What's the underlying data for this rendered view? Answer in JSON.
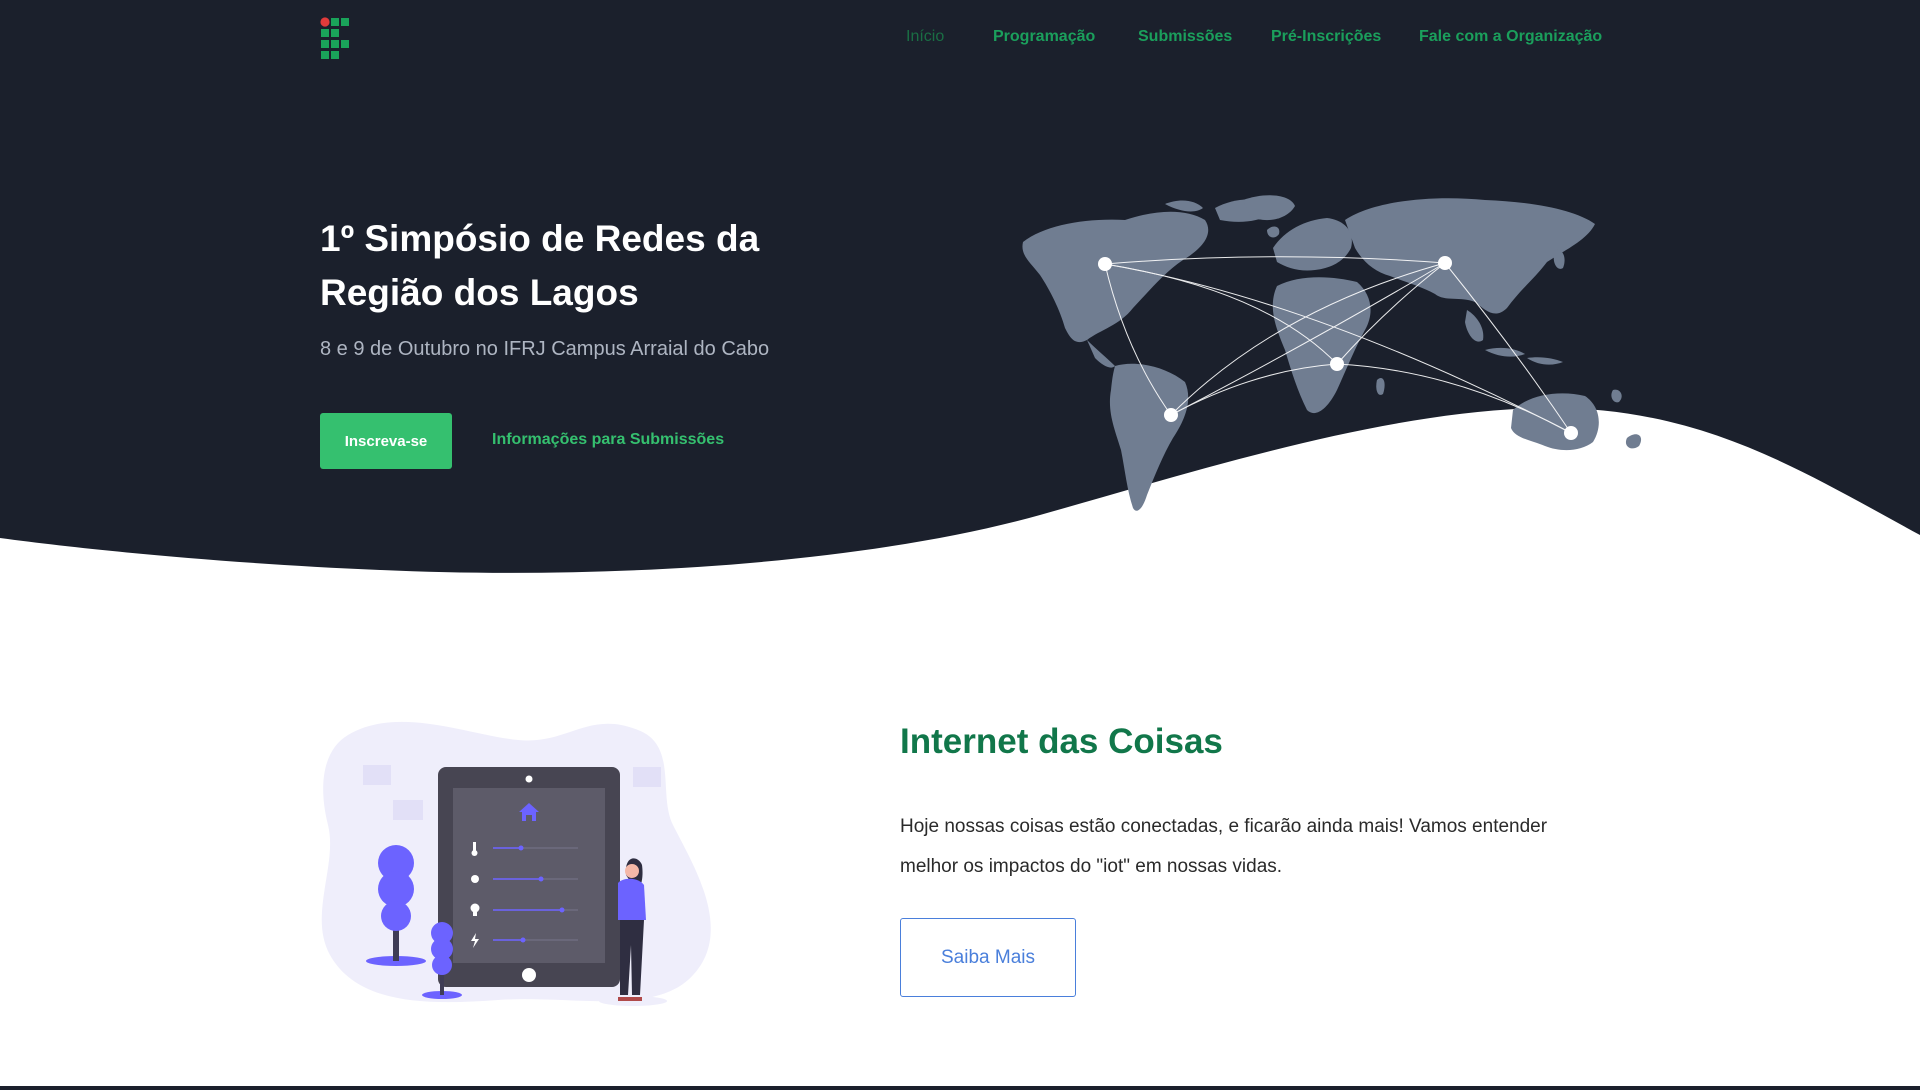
{
  "colors": {
    "dark_bg": "#1b202c",
    "accent_green": "#35c06f",
    "nav_green": "#1b9f5c",
    "heading_green": "#11774a",
    "outline_blue": "#4a7fdb",
    "map_gray": "#707d91",
    "illustration_purple": "#6c63ff"
  },
  "nav": {
    "logo_icon": "ifrj-logo",
    "items": [
      {
        "label": "Início",
        "active": true
      },
      {
        "label": "Programação"
      },
      {
        "label": "Submissões"
      },
      {
        "label": "Pré-Inscrições"
      },
      {
        "label": "Fale com a Organização"
      }
    ]
  },
  "hero": {
    "title": "1º Simpósio de Redes da Região dos Lagos",
    "subtitle": "8 e 9 de Outubro no IFRJ Campus Arraial do Cabo",
    "cta_primary": "Inscreva-se",
    "cta_secondary": "Informações para Submissões",
    "image_icon": "world-network-map"
  },
  "iot_section": {
    "image_icon": "smart-home-tablet-illustration",
    "title": "Internet das Coisas",
    "text": "Hoje nossas coisas estão conectadas, e ficarão ainda mais! Vamos entender melhor os impactos do \"iot\" em nossas vidas.",
    "button": "Saiba Mais"
  }
}
